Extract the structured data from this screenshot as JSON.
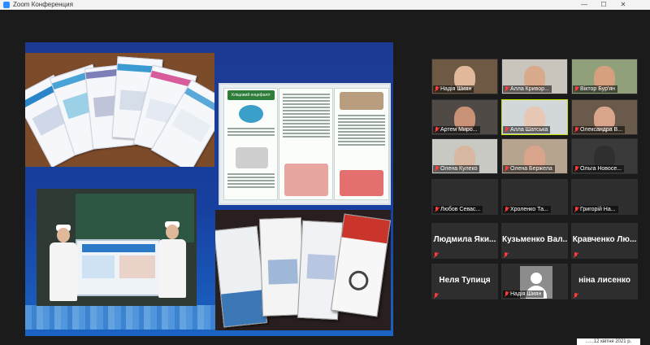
{
  "window": {
    "title": "Zoom Конференция",
    "controls": {
      "minimize": "—",
      "maximize": "☐",
      "close": "✕"
    }
  },
  "colors": {
    "active_speaker_border": "#c6e300",
    "muted_icon": "#ff3b3b",
    "tile_bg": "#2e2e2e",
    "share_bg": "#153a8f"
  },
  "share": {
    "brochure_heading": "Кліщовий енцефаліт"
  },
  "gallery": {
    "video_tiles": [
      {
        "name": "Надія Шиян",
        "muted": true,
        "active": false,
        "tint": "#6e5a44",
        "skin": "#e2b89a"
      },
      {
        "name": "Алла Кривор...",
        "muted": true,
        "active": false,
        "tint": "#c9c4bc",
        "skin": "#d8a98a"
      },
      {
        "name": "Віктор Бур'ян",
        "muted": true,
        "active": false,
        "tint": "#8fa07a",
        "skin": "#d6a07f"
      },
      {
        "name": "Артем Миро...",
        "muted": true,
        "active": false,
        "tint": "#4f4a46",
        "skin": "#c99277"
      },
      {
        "name": "Алла Шатська",
        "muted": true,
        "active": true,
        "tint": "#d2d7d9",
        "skin": "#e8c8b4"
      },
      {
        "name": "Олександра В...",
        "muted": true,
        "active": false,
        "tint": "#6a5a4b",
        "skin": "#d8a58b"
      },
      {
        "name": "Олена Кулеко",
        "muted": true,
        "active": false,
        "tint": "#c8c9c3",
        "skin": "#d9b8a2"
      },
      {
        "name": "Олена Бержела",
        "muted": true,
        "active": false,
        "tint": "#b6a48e",
        "skin": "#d9a48c"
      },
      {
        "name": "Ольга Новосе...",
        "muted": true,
        "active": false,
        "tint": "#3a3a3a",
        "skin": "#2f2f2f"
      }
    ],
    "camera_off_small": [
      {
        "name": "Любов Севас..."
      },
      {
        "name": "Хроленко Та..."
      },
      {
        "name": "Григорій  На..."
      }
    ],
    "camera_off_large": [
      {
        "name": "Людмила  Яки..."
      },
      {
        "name": "Кузьменко  Вал..."
      },
      {
        "name": "Кравченко  Лю..."
      },
      {
        "name": "Неля Тупиця"
      },
      {
        "name": "ніна лисенко"
      }
    ],
    "avatar_tile": {
      "name": "Надія Шиян"
    }
  },
  "timestamp": "......12 квітня 2021 р."
}
